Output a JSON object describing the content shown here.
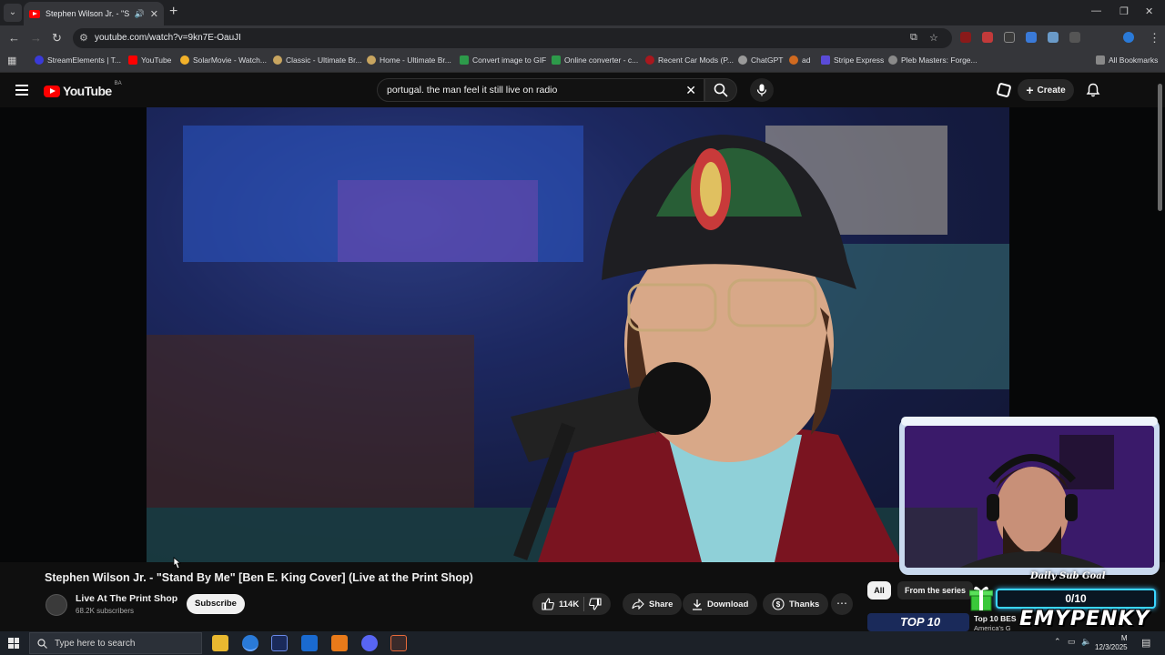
{
  "browser": {
    "tab_title": "Stephen Wilson Jr. - \"Stand",
    "url": "youtube.com/watch?v=9kn7E-OauJI",
    "bookmarks": [
      {
        "label": "StreamElements | T...",
        "color": "#3a3ad8"
      },
      {
        "label": "YouTube",
        "color": "#ff0000"
      },
      {
        "label": "SolarMovie - Watch...",
        "color": "#f2b12a"
      },
      {
        "label": "Classic - Ultimate Br...",
        "color": "#c8a560"
      },
      {
        "label": "Home - Ultimate Br...",
        "color": "#c8a560"
      },
      {
        "label": "Convert image to GIF",
        "color": "#2d9a4a"
      },
      {
        "label": "Online converter - c...",
        "color": "#2d9a4a"
      },
      {
        "label": "Recent Car Mods (P...",
        "color": "#a8181e"
      },
      {
        "label": "ChatGPT",
        "color": "#9a9a9a"
      },
      {
        "label": "ad",
        "color": "#d06a20"
      },
      {
        "label": "Stripe Express",
        "color": "#5a4bd8"
      },
      {
        "label": "Pleb Masters: Forge...",
        "color": "#8a8a8a"
      }
    ],
    "all_bookmarks": "All Bookmarks"
  },
  "youtube": {
    "logo_text": "YouTube",
    "country_code": "BA",
    "search_query": "portugal. the man feel it still live on radio",
    "create_label": "Create",
    "video": {
      "title": "Stephen Wilson Jr. - \"Stand By Me\" [Ben E. King Cover] (Live at the Print Shop)",
      "channel": "Live At The Print Shop",
      "subscribers": "68.2K subscribers",
      "subscribe_label": "Subscribe",
      "likes": "114K",
      "share_label": "Share",
      "download_label": "Download",
      "thanks_label": "Thanks"
    },
    "chips": {
      "all": "All",
      "from_series": "From the series"
    },
    "recommendation": {
      "thumb_text": "TOP 10",
      "title": "Top 10 BES",
      "sub": "America's G"
    }
  },
  "overlay": {
    "goal_label": "Daily Sub Goal",
    "goal_value": "0/10",
    "streamer": "EMYPENKY"
  },
  "taskbar": {
    "search_placeholder": "Type here to search",
    "date": "12/3/2025",
    "time_suffix": "M"
  },
  "icons": [
    "search-icon",
    "mic-icon",
    "bell-icon",
    "like-icon",
    "dislike-icon",
    "share-icon",
    "download-icon",
    "thanks-icon",
    "more-icon"
  ]
}
